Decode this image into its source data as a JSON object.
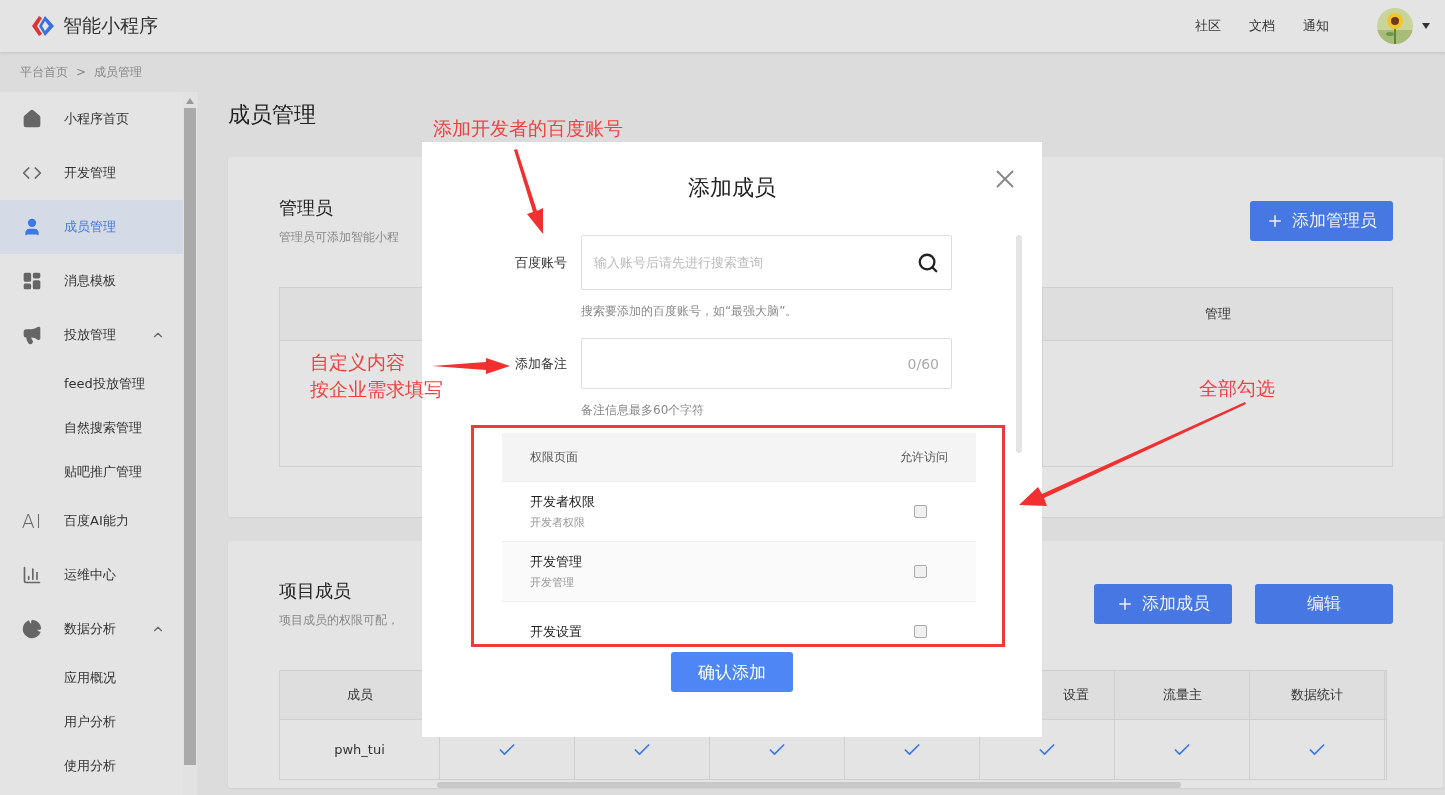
{
  "header": {
    "logo_text": "智能小程序",
    "nav": [
      {
        "label": "社区"
      },
      {
        "label": "文档"
      },
      {
        "label": "通知"
      }
    ]
  },
  "breadcrumb": [
    {
      "label": "平台首页"
    },
    {
      "label": ">"
    },
    {
      "label": "成员管理"
    }
  ],
  "sidebar": {
    "items": [
      {
        "label": "小程序首页",
        "selected": false
      },
      {
        "label": "开发管理",
        "selected": false
      },
      {
        "label": "成员管理",
        "selected": true
      },
      {
        "label": "消息模板",
        "selected": false
      },
      {
        "label": "投放管理",
        "selected": false,
        "expanded": true,
        "children": [
          {
            "label": "feed投放管理",
            "selected": false
          },
          {
            "label": "自然搜索管理",
            "selected": false
          },
          {
            "label": "贴吧推广管理",
            "selected": false
          }
        ]
      },
      {
        "label": "百度AI能力",
        "icon_text": "AI",
        "selected": false
      },
      {
        "label": "运维中心",
        "selected": false
      },
      {
        "label": "数据分析",
        "selected": false,
        "expanded": true,
        "children": [
          {
            "label": "应用概况",
            "selected": false
          },
          {
            "label": "用户分析",
            "selected": false
          },
          {
            "label": "使用分析",
            "selected": false
          }
        ]
      }
    ]
  },
  "page_title": "成员管理",
  "admin_section": {
    "title": "管理员",
    "description": "管理员可添加智能小程",
    "button": {
      "label": "添加管理员",
      "kind": "add"
    },
    "table": {
      "columns": [
        {
          "label": "管理"
        }
      ]
    }
  },
  "members_section": {
    "title": "项目成员",
    "description": "项目成员的权限可配，",
    "buttons": [
      {
        "label": "添加成员",
        "kind": "add"
      },
      {
        "label": "编辑",
        "kind": "plain"
      }
    ],
    "table": {
      "columns": [
        {
          "label": "成员"
        },
        {
          "label": "设置"
        },
        {
          "label": "流量主"
        },
        {
          "label": "数据统计"
        }
      ],
      "rows": [
        {
          "member": "pwh_tui",
          "permissions": [
            true,
            true,
            true,
            true,
            true,
            true,
            true
          ]
        }
      ]
    }
  },
  "dialog": {
    "title": "添加成员",
    "fields": [
      {
        "label": "百度账号",
        "kind": "search",
        "placeholder": "输入账号后请先进行搜索查询",
        "help": "搜索要添加的百度账号，如“最强大脑”。"
      },
      {
        "label": "添加备注",
        "kind": "counter",
        "counter": "0/60",
        "help": "备注信息最多60个字符"
      }
    ],
    "permissions": {
      "columns": [
        {
          "label": "权限页面"
        },
        {
          "label": "允许访问"
        }
      ],
      "rows": [
        {
          "title": "开发者权限",
          "subtitle": "开发者权限",
          "checked": false
        },
        {
          "title": "开发管理",
          "subtitle": "开发管理",
          "checked": false
        },
        {
          "title": "开发设置",
          "checked": false
        }
      ]
    },
    "confirm": "确认添加"
  },
  "annotations": [
    {
      "lines": [
        "添加开发者的百度账号"
      ]
    },
    {
      "lines": [
        "自定义内容",
        "按企业需求填写"
      ]
    },
    {
      "lines": [
        "全部勾选"
      ]
    }
  ]
}
